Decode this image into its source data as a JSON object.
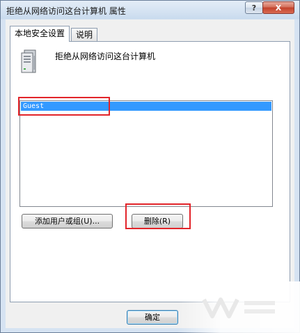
{
  "window": {
    "title": "拒绝从网络访问这台计算机 属性",
    "help_glyph": "?",
    "close_glyph": "X"
  },
  "tabs": [
    {
      "label": "本地安全设置",
      "selected": true
    },
    {
      "label": "说明",
      "selected": false
    }
  ],
  "policy": {
    "title": "拒绝从网络访问这台计算机",
    "icon": "server-tower-icon"
  },
  "list": {
    "items": [
      {
        "label": "Guest",
        "selected": true
      }
    ]
  },
  "buttons": {
    "add": "添加用户或组(U)...",
    "remove": "删除(R)",
    "ok": "确定"
  },
  "colors": {
    "selection": "#3399ff",
    "highlight_box": "#e2242a"
  }
}
